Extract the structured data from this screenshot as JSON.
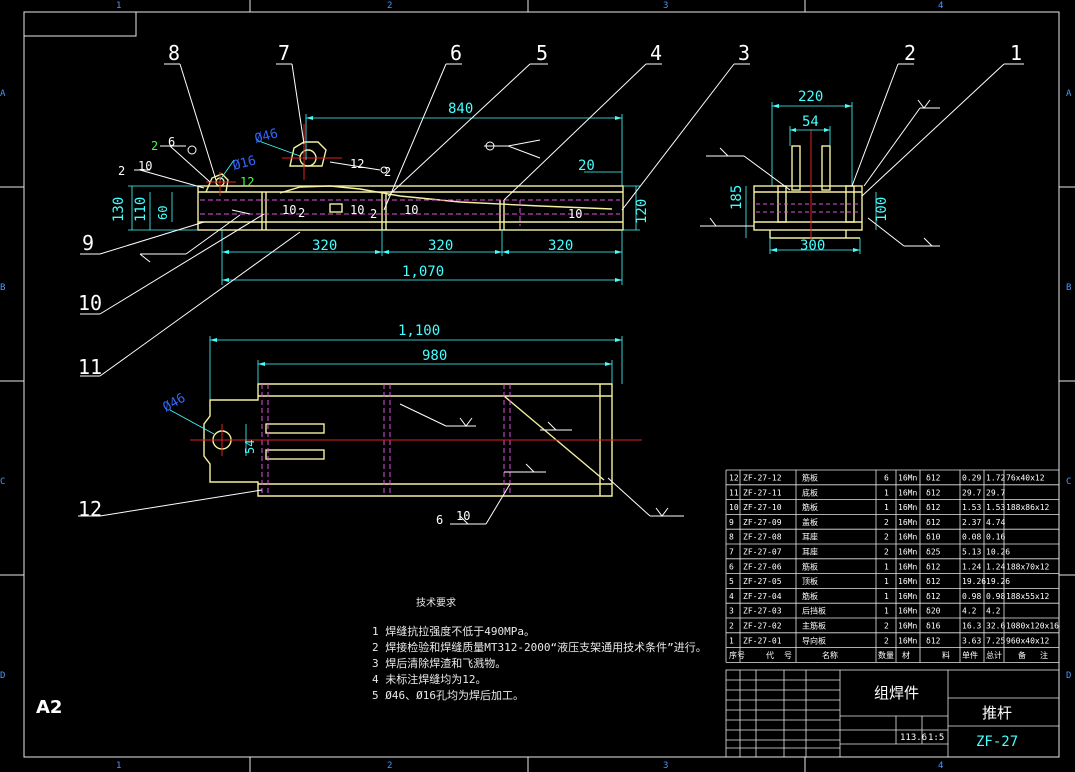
{
  "border": {
    "top_numbers": [
      "1",
      "2",
      "3",
      "4"
    ],
    "bottom_numbers": [
      "1",
      "2",
      "3",
      "4"
    ],
    "left_letters": [
      "A",
      "B",
      "C",
      "D"
    ],
    "right_letters": [
      "A",
      "B",
      "C",
      "D"
    ]
  },
  "sheet_size": "A2",
  "balloons": [
    "1",
    "2",
    "3",
    "4",
    "5",
    "6",
    "7",
    "8",
    "9",
    "10",
    "11",
    "12"
  ],
  "front_view": {
    "dims": {
      "d840": "840",
      "d320a": "320",
      "d320b": "320",
      "d320c": "320",
      "d1070": "1,070",
      "d20": "20",
      "d120": "120",
      "d130": "130",
      "d110": "110",
      "d60": "60",
      "phi46": "Ø46",
      "phi16": "Ø16"
    },
    "welds": {
      "w_10a": "10",
      "w_10b": "10",
      "w_10c": "10",
      "w_10d": "10",
      "w_2a": "2",
      "w_2b": "2",
      "w_2c": "2",
      "w_2d": "2",
      "w_12": "12",
      "w_12b": "12",
      "w_6": "6",
      "w_10e": "10"
    }
  },
  "side_view": {
    "dims": {
      "d220": "220",
      "d54": "54",
      "d185": "185",
      "d100": "100",
      "d300": "300"
    }
  },
  "top_view": {
    "dims": {
      "d1100": "1,100",
      "d980": "980",
      "phi46": "Ø46",
      "d54": "54"
    },
    "welds": {
      "w_6": "6",
      "w_10": "10"
    }
  },
  "notes": {
    "title": "技术要求",
    "lines": [
      "1  焊缝抗拉强度不低于490MPa。",
      "2  焊接检验和焊缝质量MT312-2000“液压支架通用技术条件”进行。",
      "3  焊后清除焊渣和飞溅物。",
      "4  未标注焊缝均为12。",
      "5  Ø46、Ø16孔均为焊后加工。"
    ]
  },
  "bom": {
    "rows": [
      [
        "12",
        "ZF-27-12",
        "筋板",
        "6",
        "16Mn",
        "δ12",
        "0.29",
        "1.72",
        "76x40x12"
      ],
      [
        "11",
        "ZF-27-11",
        "底板",
        "1",
        "16Mn",
        "δ12",
        "29.7",
        "29.7",
        ""
      ],
      [
        "10",
        "ZF-27-10",
        "筋板",
        "1",
        "16Mn",
        "δ12",
        "1.53",
        "1.53",
        "188x86x12"
      ],
      [
        "9",
        "ZF-27-09",
        "盖板",
        "2",
        "16Mn",
        "δ12",
        "2.37",
        "4.74",
        ""
      ],
      [
        "8",
        "ZF-27-08",
        "耳座",
        "2",
        "16Mn",
        "δ10",
        "0.08",
        "0.16",
        ""
      ],
      [
        "7",
        "ZF-27-07",
        "耳座",
        "2",
        "16Mn",
        "δ25",
        "5.13",
        "10.26",
        ""
      ],
      [
        "6",
        "ZF-27-06",
        "筋板",
        "1",
        "16Mn",
        "δ12",
        "1.24",
        "1.24",
        "188x70x12"
      ],
      [
        "5",
        "ZF-27-05",
        "顶板",
        "1",
        "16Mn",
        "δ12",
        "19.26",
        "19.26",
        ""
      ],
      [
        "4",
        "ZF-27-04",
        "筋板",
        "1",
        "16Mn",
        "δ12",
        "0.98",
        "0.98",
        "188x55x12"
      ],
      [
        "3",
        "ZF-27-03",
        "后挡板",
        "1",
        "16Mn",
        "δ20",
        "4.2",
        "4.2",
        ""
      ],
      [
        "2",
        "ZF-27-02",
        "主筋板",
        "2",
        "16Mn",
        "δ16",
        "16.3",
        "32.6",
        "1080x120x16"
      ],
      [
        "1",
        "ZF-27-01",
        "导向板",
        "2",
        "16Mn",
        "δ12",
        "3.63",
        "7.25",
        "960x40x12"
      ]
    ],
    "header": [
      "序号",
      "代",
      "号",
      "名称",
      "数量",
      "材",
      "料",
      "单件",
      "总计",
      "备",
      "注"
    ]
  },
  "title_block": {
    "drawing_type": "组焊件",
    "part_name": "推杆",
    "drawing_no": "ZF-27",
    "weight": "113.6",
    "scale": "1:5"
  }
}
